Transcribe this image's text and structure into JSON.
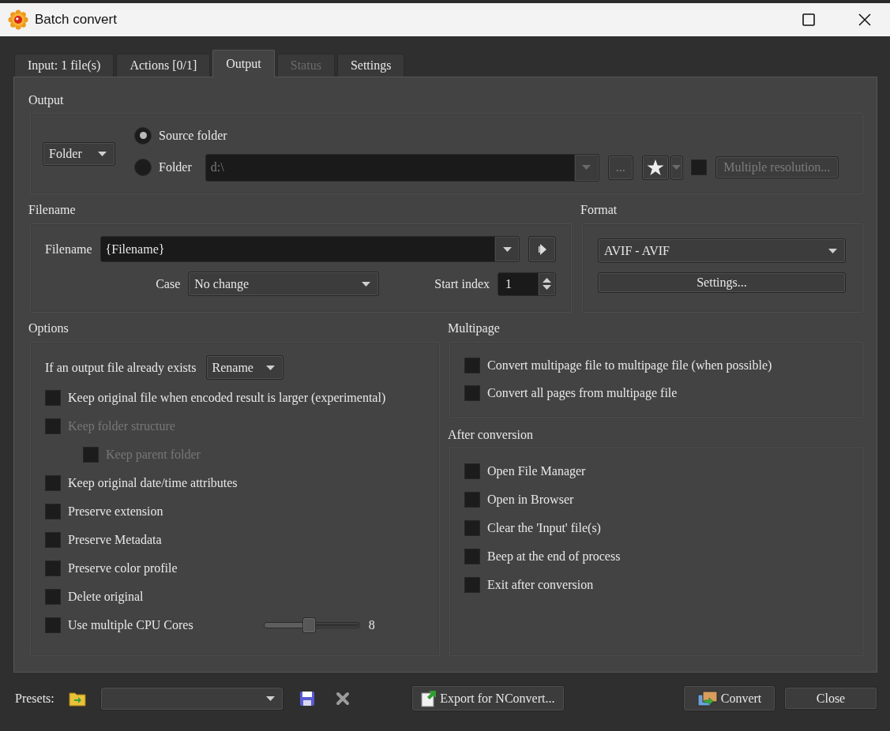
{
  "window": {
    "title": "Batch convert"
  },
  "tabs": [
    {
      "label": "Input: 1 file(s)",
      "selected": false,
      "disabled": false
    },
    {
      "label": "Actions [0/1]",
      "selected": false,
      "disabled": false
    },
    {
      "label": "Output",
      "selected": true,
      "disabled": false
    },
    {
      "label": "Status",
      "selected": false,
      "disabled": true
    },
    {
      "label": "Settings",
      "selected": false,
      "disabled": false
    }
  ],
  "output": {
    "heading": "Output",
    "destination": "Folder",
    "radios": [
      {
        "label": "Source folder",
        "selected": true
      },
      {
        "label": "Folder",
        "selected": false
      }
    ],
    "path": {
      "value": "d:\\",
      "disabled": true
    },
    "browse_button": {
      "label": "...",
      "disabled": true
    },
    "multi_resolution": {
      "checked": false,
      "label": "Multiple resolution...",
      "disabled": true
    }
  },
  "filename": {
    "heading": "Filename",
    "label": "Filename",
    "value": "{Filename}",
    "case_label": "Case",
    "case_value": "No change",
    "start_index_label": "Start index",
    "start_index": "1"
  },
  "format": {
    "heading": "Format",
    "value": "AVIF - AVIF",
    "settings_button": "Settings..."
  },
  "options": {
    "heading": "Options",
    "exists_label": "If an output file already exists",
    "exists_value": "Rename",
    "items": [
      {
        "kind": "checkbox",
        "label": "Keep original file when encoded result is larger (experimental)",
        "checked": false,
        "disabled": false
      },
      {
        "kind": "checkbox",
        "label": "Keep folder structure",
        "checked": false,
        "disabled": true,
        "children": [
          {
            "kind": "checkbox",
            "label": "Keep parent folder",
            "checked": false,
            "disabled": true
          }
        ]
      },
      {
        "kind": "checkbox",
        "label": "Keep original date/time attributes",
        "checked": false,
        "disabled": false
      },
      {
        "kind": "checkbox",
        "label": "Preserve extension",
        "checked": false,
        "disabled": false
      },
      {
        "kind": "checkbox",
        "label": "Preserve Metadata",
        "checked": false,
        "disabled": false
      },
      {
        "kind": "checkbox",
        "label": "Preserve color profile",
        "checked": false,
        "disabled": false
      },
      {
        "kind": "checkbox",
        "label": "Delete original",
        "checked": false,
        "disabled": false
      },
      {
        "kind": "slider",
        "label": "Use multiple CPU Cores",
        "checked": false,
        "disabled": false,
        "level": 0.47,
        "reading": "8"
      }
    ]
  },
  "multipage": {
    "heading": "Multipage",
    "items": [
      {
        "kind": "checkbox",
        "label": "Convert multipage file to multipage file (when possible)",
        "checked": false,
        "disabled": false
      },
      {
        "kind": "checkbox",
        "label": "Convert all pages from multipage file",
        "checked": false,
        "disabled": false
      }
    ]
  },
  "after_conversion": {
    "heading": "After conversion",
    "items": [
      {
        "kind": "checkbox",
        "label": "Open File Manager",
        "checked": false,
        "disabled": false
      },
      {
        "kind": "checkbox",
        "label": "Open in Browser",
        "checked": false,
        "disabled": false
      },
      {
        "kind": "checkbox",
        "label": "Clear the 'Input' file(s)",
        "checked": false,
        "disabled": false
      },
      {
        "kind": "checkbox",
        "label": "Beep at the end of process",
        "checked": false,
        "disabled": false
      },
      {
        "kind": "checkbox",
        "label": "Exit after conversion",
        "checked": false,
        "disabled": false
      }
    ]
  },
  "footer": {
    "presets_label": "Presets:",
    "buttons": [
      {
        "kind": "export",
        "label": "Export for NConvert..."
      },
      {
        "kind": "convert",
        "label": "Convert"
      },
      {
        "kind": "close",
        "label": "Close"
      }
    ]
  }
}
